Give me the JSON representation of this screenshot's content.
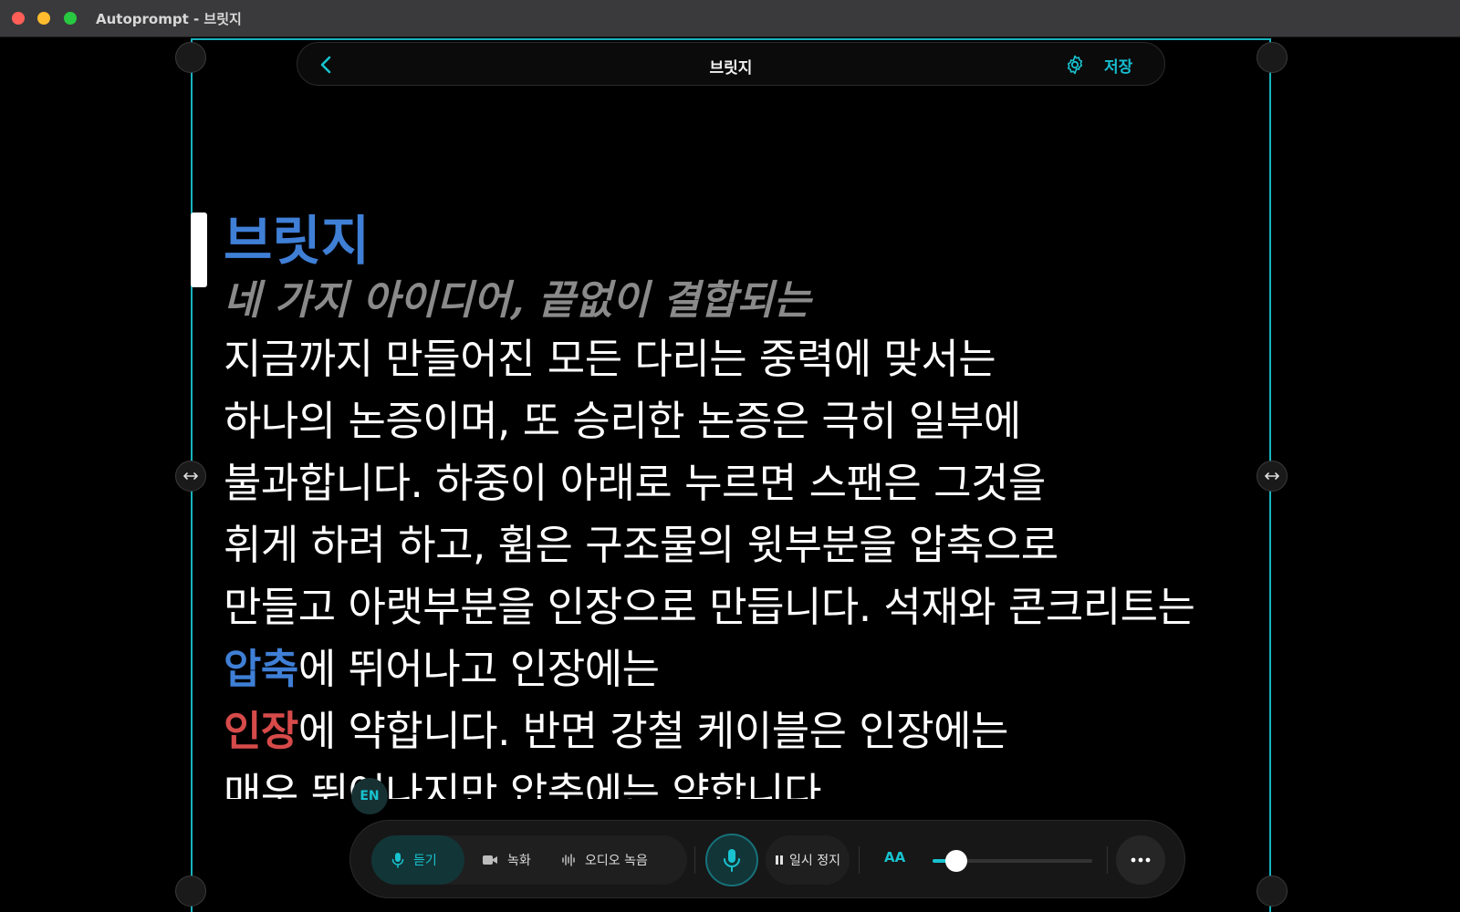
{
  "window": {
    "title": "Autoprompt - 브릿지"
  },
  "topbar": {
    "title": "브릿지",
    "save_label": "저장"
  },
  "document": {
    "title": "브릿지",
    "subtitle": "네 가지 아이디어, 끝없이 결합되는",
    "lines": [
      "지금까지 만들어진 모든 다리는 중력에 맞서는",
      "하나의 논증이며, 또 승리한 논증은 극히 일부에",
      "불과합니다. 하중이 아래로 누르면 스팬은 그것을",
      "휘게 하려 하고, 휨은 구조물의 윗부분을 압축으로",
      "만들고 아랫부분을 인장으로 만듭니다. 석재와 콘크리트는"
    ],
    "line6": {
      "highlight": "압축",
      "rest": "에 뛰어나고 인장에는"
    },
    "line7": {
      "highlight": "인장",
      "rest": "에 약합니다. 반면 강철 케이블은 인장에는"
    },
    "line8": "매우 뛰어나지만 압축에는 약합니다",
    "highlight_colors": {
      "blue": "#3f7fd6",
      "red": "#d64a4a"
    }
  },
  "language_badge": "EN",
  "toolbar": {
    "modes": [
      {
        "label": "듣기",
        "icon": "mic-icon",
        "active": true
      },
      {
        "label": "녹화",
        "icon": "video-icon",
        "active": false
      },
      {
        "label": "오디오 녹음",
        "icon": "waveform-icon",
        "active": false
      }
    ],
    "pause_label": "일시 정지",
    "font_size_label": "AA",
    "font_size_level": 0.15,
    "accent_color": "#18c3cf"
  }
}
